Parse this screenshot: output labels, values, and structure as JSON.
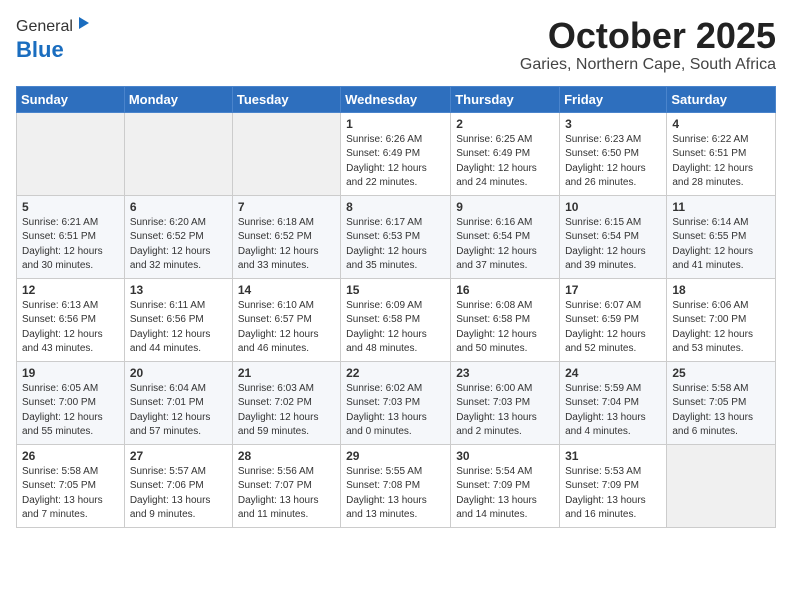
{
  "header": {
    "logo_line1": "General",
    "logo_line2": "Blue",
    "month": "October 2025",
    "location": "Garies, Northern Cape, South Africa"
  },
  "weekdays": [
    "Sunday",
    "Monday",
    "Tuesday",
    "Wednesday",
    "Thursday",
    "Friday",
    "Saturday"
  ],
  "weeks": [
    [
      {
        "day": "",
        "content": ""
      },
      {
        "day": "",
        "content": ""
      },
      {
        "day": "",
        "content": ""
      },
      {
        "day": "1",
        "content": "Sunrise: 6:26 AM\nSunset: 6:49 PM\nDaylight: 12 hours and 22 minutes."
      },
      {
        "day": "2",
        "content": "Sunrise: 6:25 AM\nSunset: 6:49 PM\nDaylight: 12 hours and 24 minutes."
      },
      {
        "day": "3",
        "content": "Sunrise: 6:23 AM\nSunset: 6:50 PM\nDaylight: 12 hours and 26 minutes."
      },
      {
        "day": "4",
        "content": "Sunrise: 6:22 AM\nSunset: 6:51 PM\nDaylight: 12 hours and 28 minutes."
      }
    ],
    [
      {
        "day": "5",
        "content": "Sunrise: 6:21 AM\nSunset: 6:51 PM\nDaylight: 12 hours and 30 minutes."
      },
      {
        "day": "6",
        "content": "Sunrise: 6:20 AM\nSunset: 6:52 PM\nDaylight: 12 hours and 32 minutes."
      },
      {
        "day": "7",
        "content": "Sunrise: 6:18 AM\nSunset: 6:52 PM\nDaylight: 12 hours and 33 minutes."
      },
      {
        "day": "8",
        "content": "Sunrise: 6:17 AM\nSunset: 6:53 PM\nDaylight: 12 hours and 35 minutes."
      },
      {
        "day": "9",
        "content": "Sunrise: 6:16 AM\nSunset: 6:54 PM\nDaylight: 12 hours and 37 minutes."
      },
      {
        "day": "10",
        "content": "Sunrise: 6:15 AM\nSunset: 6:54 PM\nDaylight: 12 hours and 39 minutes."
      },
      {
        "day": "11",
        "content": "Sunrise: 6:14 AM\nSunset: 6:55 PM\nDaylight: 12 hours and 41 minutes."
      }
    ],
    [
      {
        "day": "12",
        "content": "Sunrise: 6:13 AM\nSunset: 6:56 PM\nDaylight: 12 hours and 43 minutes."
      },
      {
        "day": "13",
        "content": "Sunrise: 6:11 AM\nSunset: 6:56 PM\nDaylight: 12 hours and 44 minutes."
      },
      {
        "day": "14",
        "content": "Sunrise: 6:10 AM\nSunset: 6:57 PM\nDaylight: 12 hours and 46 minutes."
      },
      {
        "day": "15",
        "content": "Sunrise: 6:09 AM\nSunset: 6:58 PM\nDaylight: 12 hours and 48 minutes."
      },
      {
        "day": "16",
        "content": "Sunrise: 6:08 AM\nSunset: 6:58 PM\nDaylight: 12 hours and 50 minutes."
      },
      {
        "day": "17",
        "content": "Sunrise: 6:07 AM\nSunset: 6:59 PM\nDaylight: 12 hours and 52 minutes."
      },
      {
        "day": "18",
        "content": "Sunrise: 6:06 AM\nSunset: 7:00 PM\nDaylight: 12 hours and 53 minutes."
      }
    ],
    [
      {
        "day": "19",
        "content": "Sunrise: 6:05 AM\nSunset: 7:00 PM\nDaylight: 12 hours and 55 minutes."
      },
      {
        "day": "20",
        "content": "Sunrise: 6:04 AM\nSunset: 7:01 PM\nDaylight: 12 hours and 57 minutes."
      },
      {
        "day": "21",
        "content": "Sunrise: 6:03 AM\nSunset: 7:02 PM\nDaylight: 12 hours and 59 minutes."
      },
      {
        "day": "22",
        "content": "Sunrise: 6:02 AM\nSunset: 7:03 PM\nDaylight: 13 hours and 0 minutes."
      },
      {
        "day": "23",
        "content": "Sunrise: 6:00 AM\nSunset: 7:03 PM\nDaylight: 13 hours and 2 minutes."
      },
      {
        "day": "24",
        "content": "Sunrise: 5:59 AM\nSunset: 7:04 PM\nDaylight: 13 hours and 4 minutes."
      },
      {
        "day": "25",
        "content": "Sunrise: 5:58 AM\nSunset: 7:05 PM\nDaylight: 13 hours and 6 minutes."
      }
    ],
    [
      {
        "day": "26",
        "content": "Sunrise: 5:58 AM\nSunset: 7:05 PM\nDaylight: 13 hours and 7 minutes."
      },
      {
        "day": "27",
        "content": "Sunrise: 5:57 AM\nSunset: 7:06 PM\nDaylight: 13 hours and 9 minutes."
      },
      {
        "day": "28",
        "content": "Sunrise: 5:56 AM\nSunset: 7:07 PM\nDaylight: 13 hours and 11 minutes."
      },
      {
        "day": "29",
        "content": "Sunrise: 5:55 AM\nSunset: 7:08 PM\nDaylight: 13 hours and 13 minutes."
      },
      {
        "day": "30",
        "content": "Sunrise: 5:54 AM\nSunset: 7:09 PM\nDaylight: 13 hours and 14 minutes."
      },
      {
        "day": "31",
        "content": "Sunrise: 5:53 AM\nSunset: 7:09 PM\nDaylight: 13 hours and 16 minutes."
      },
      {
        "day": "",
        "content": ""
      }
    ]
  ]
}
